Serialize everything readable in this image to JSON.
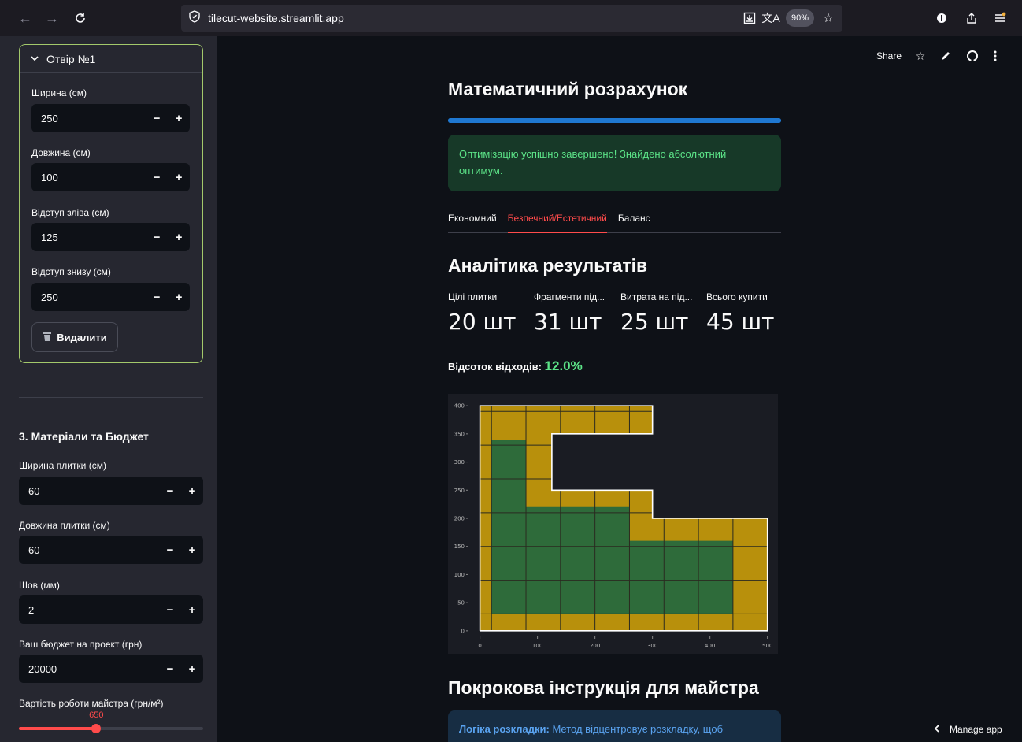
{
  "browser": {
    "back_icon": "←",
    "forward_icon": "→",
    "reload_icon": "C",
    "url": "tilecut-website.streamlit.app",
    "zoom": "90%"
  },
  "sidebar": {
    "expander_title": "Отвір №1",
    "opening_fields": [
      {
        "label": "Ширина (см)",
        "value": "250"
      },
      {
        "label": "Довжина (см)",
        "value": "100"
      },
      {
        "label": "Відступ зліва (см)",
        "value": "125"
      },
      {
        "label": "Відступ знизу (см)",
        "value": "250"
      }
    ],
    "delete_label": "Видалити",
    "section_title": "3. Матеріали та Бюджет",
    "material_fields": [
      {
        "label": "Ширина плитки (см)",
        "value": "60"
      },
      {
        "label": "Довжина плитки (см)",
        "value": "60"
      },
      {
        "label": "Шов (мм)",
        "value": "2"
      },
      {
        "label": "Ваш бюджет на проект (грн)",
        "value": "20000"
      }
    ],
    "minus": "−",
    "plus": "+",
    "slider": {
      "label": "Вартість роботи майстра (грн/м²)",
      "value": "650",
      "fraction": 0.42
    }
  },
  "header": {
    "share_label": "Share"
  },
  "main": {
    "title": "Математичний розрахунок",
    "progress_percent": 100,
    "success_message": "Оптимізацію успішно завершено! Знайдено абсолютний оптимум.",
    "tabs": [
      {
        "label": "Економний",
        "active": false
      },
      {
        "label": "Безпечний/Естетичний",
        "active": true
      },
      {
        "label": "Баланс",
        "active": false
      }
    ],
    "analytics_title": "Аналітика результатів",
    "metrics": [
      {
        "label": "Цілі плитки",
        "value": "20 шт"
      },
      {
        "label": "Фрагменти під...",
        "value": "31 шт"
      },
      {
        "label": "Витрата на під...",
        "value": "25 шт"
      },
      {
        "label": "Всього купити",
        "value": "45 шт"
      }
    ],
    "waste_label": "Відсоток відходів:",
    "waste_value": "12.0%",
    "steps_title": "Покрокова інструкція для майстра",
    "info_bold": "Логіка розкладки:",
    "info_text": " Метод відцентровує розкладку, щоб"
  },
  "manage_app": "Manage app",
  "colors": {
    "tile_full": "#2e6b3a",
    "tile_cut": "#b8900c",
    "outline": "#ffffff",
    "accent_red": "#ff4b4b",
    "accent_blue": "#1f78d1"
  },
  "chart_data": {
    "type": "heatmap",
    "xlim": [
      -20,
      510
    ],
    "ylim": [
      -10,
      410
    ],
    "xticks": [
      0,
      100,
      200,
      300,
      400,
      500
    ],
    "yticks": [
      0,
      50,
      100,
      150,
      200,
      250,
      300,
      350,
      400
    ],
    "room_outline": [
      [
        0,
        0
      ],
      [
        500,
        0
      ],
      [
        500,
        200
      ],
      [
        300,
        200
      ],
      [
        300,
        250
      ],
      [
        125,
        250
      ],
      [
        125,
        350
      ],
      [
        300,
        350
      ],
      [
        300,
        400
      ],
      [
        0,
        400
      ],
      [
        0,
        0
      ]
    ],
    "tile_grid_x": [
      20,
      80,
      140,
      200,
      260,
      320,
      380,
      440
    ],
    "tile_grid_y": [
      30,
      90,
      150,
      210,
      270,
      330,
      390
    ],
    "full_tile_region": [
      [
        20,
        30
      ],
      [
        440,
        30
      ],
      [
        440,
        160
      ],
      [
        260,
        160
      ],
      [
        260,
        220
      ],
      [
        80,
        220
      ],
      [
        80,
        340
      ],
      [
        20,
        340
      ],
      [
        20,
        30
      ]
    ]
  }
}
